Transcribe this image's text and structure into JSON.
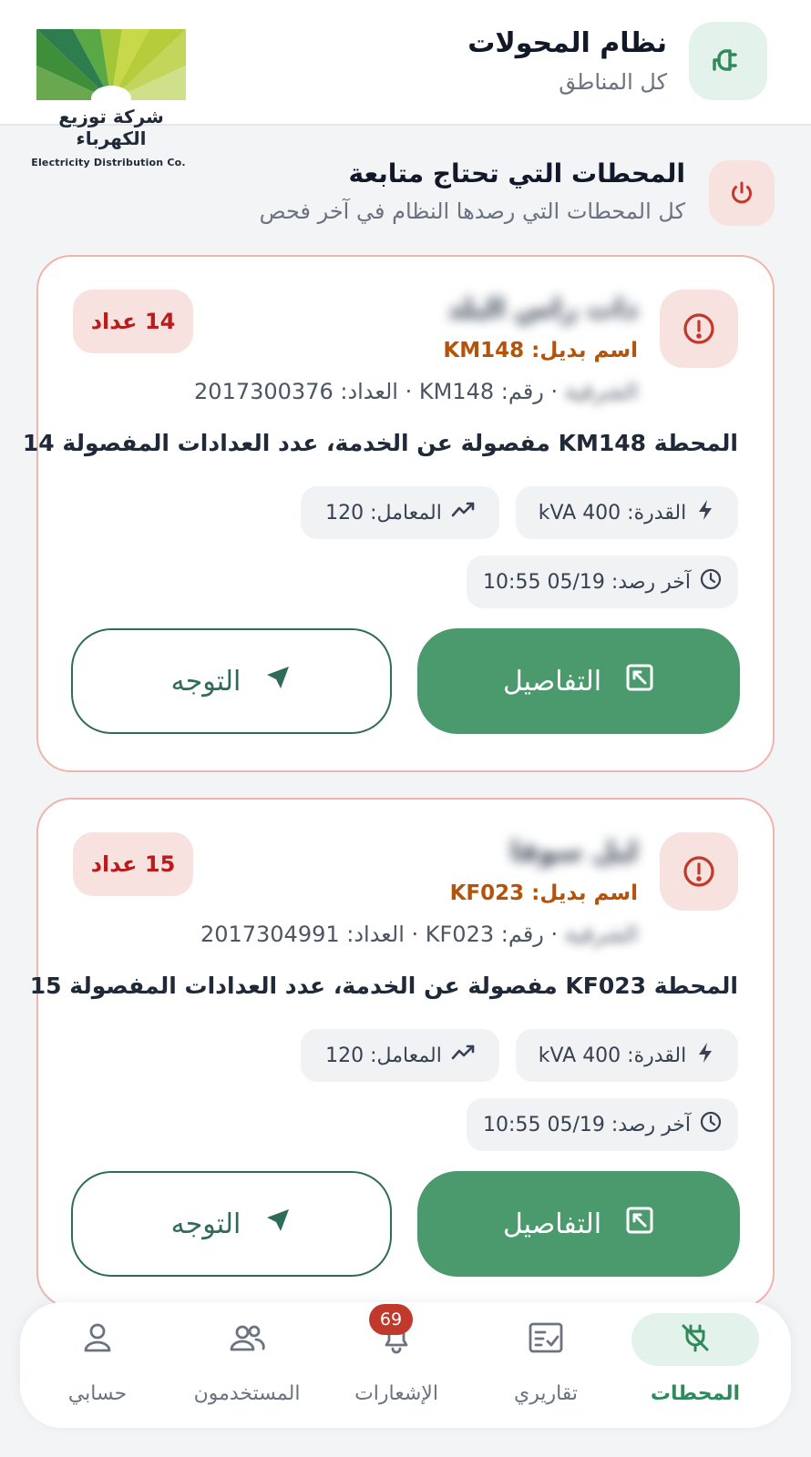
{
  "header": {
    "title": "نظام المحولات",
    "subtitle": "كل المناطق",
    "logo_text_ar": "شركة توزيع الكهرباء",
    "logo_text_en": "Electricity Distribution Co."
  },
  "section": {
    "title": "المحطات التي تحتاج متابعة",
    "subtitle": "كل المحطات التي رصدها النظام في آخر فحص"
  },
  "cards": [
    {
      "name": "ذات راس البلد",
      "alt_name": "اسم بديل: KM148",
      "region": "الشرقية",
      "meta": "· رقم: KM148 · العداد: 2017300376",
      "count_badge": "14 عداد",
      "message": "المحطة KM148 مفصولة عن الخدمة، عدد العدادات المفصولة 14",
      "capacity": "القدرة: 400 kVA",
      "factor": "المعامل: 120",
      "last_seen": "آخر رصد: 05/19 10:55",
      "details_label": "التفاصيل",
      "route_label": "التوجه"
    },
    {
      "name": "ليل سوقا",
      "alt_name": "اسم بديل: KF023",
      "region": "الشرقية",
      "meta": "· رقم: KF023 · العداد: 2017304991",
      "count_badge": "15 عداد",
      "message": "المحطة KF023 مفصولة عن الخدمة، عدد العدادات المفصولة 15",
      "capacity": "القدرة: 400 kVA",
      "factor": "المعامل: 120",
      "last_seen": "آخر رصد: 05/19 10:55",
      "details_label": "التفاصيل",
      "route_label": "التوجه"
    }
  ],
  "nav": {
    "stations": "المحطات",
    "reports": "تقاريري",
    "alerts": "الإشعارات",
    "alerts_badge": "69",
    "users": "المستخدمون",
    "account": "حسابي"
  },
  "colors": {
    "primary_green": "#4a9a6d",
    "alert_red": "#b91c1c",
    "alt_name_orange": "#b45309",
    "card_border": "#f0b3ad"
  },
  "icons": {
    "app": "plug-icon",
    "section": "power-icon",
    "alert": "exclamation-circle-icon",
    "capacity": "bolt-icon",
    "factor": "trend-icon",
    "time": "clock-icon",
    "details": "expand-icon",
    "route": "navigation-arrow-icon"
  }
}
